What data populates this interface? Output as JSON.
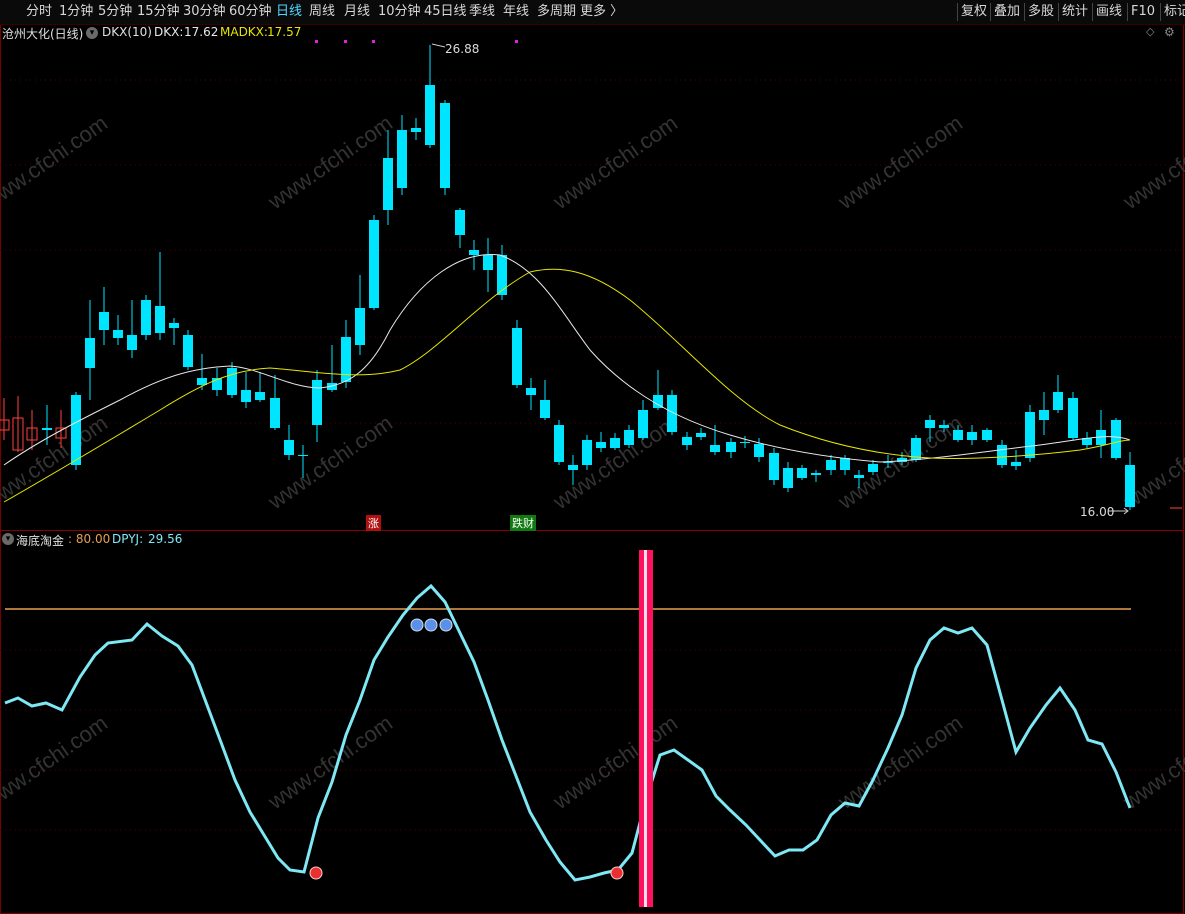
{
  "toolbar": {
    "periods": [
      "分时",
      "1分钟",
      "5分钟",
      "15分钟",
      "30分钟",
      "60分钟",
      "日线",
      "周线",
      "月线",
      "10分钟",
      "45日线",
      "季线",
      "年线",
      "多周期",
      "更多 〉"
    ],
    "active_period": "日线",
    "right_tools": [
      "复权",
      "叠加",
      "多股",
      "统计",
      "画线",
      "F10",
      "标记"
    ]
  },
  "main_panel": {
    "stock_name": "沧州大化(日线)",
    "indicator_name": "DKX(10)",
    "dkx_label": "DKX:",
    "dkx_value": "17.62",
    "madkx_label": "MADKX:",
    "madkx_value": "17.57",
    "high_marker": "26.88",
    "low_marker": "16.00",
    "signal_up": "涨",
    "signal_down": "跌财",
    "colors": {
      "dkx": "#e8e8e8",
      "madkx": "#e6e600",
      "up": "#ff4040",
      "down": "#00e5ff"
    }
  },
  "lower_panel": {
    "indicator_name": "海底淘金",
    "level_value": ": 80.00",
    "dpyj_label": "DPYJ:",
    "dpyj_value": "29.56",
    "colors": {
      "line": "#7ee8f5",
      "level": "#e8a050",
      "bar": "#ff1060"
    }
  },
  "icons": [
    "collapse-icon",
    "diamond-icon",
    "settings-icon"
  ],
  "watermark": "www.cfchi.com",
  "price_scale": {
    "min": 16.0,
    "max": 26.88
  },
  "dpyj_scale": {
    "max": 80
  }
}
